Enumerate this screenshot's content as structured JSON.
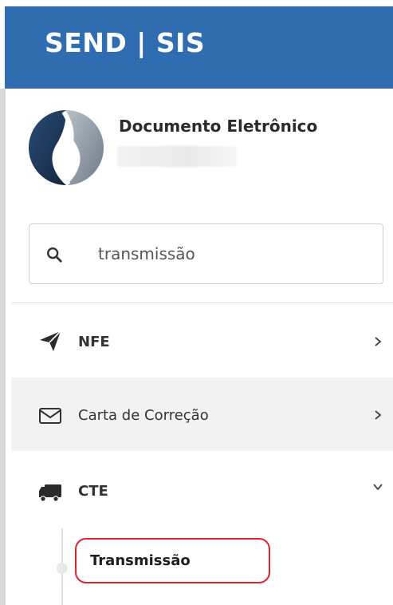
{
  "header": {
    "brand": "SEND | SIS"
  },
  "profile": {
    "title": "Documento Eletrônico",
    "logo_icon": "company-logo"
  },
  "search": {
    "value": "transmissão",
    "icon": "search-icon"
  },
  "menu": {
    "items": [
      {
        "label": "NFE",
        "icon": "paper-plane-icon",
        "chevron": "chevron-right-icon",
        "active": false
      },
      {
        "label": "Carta de Correção",
        "icon": "envelope-icon",
        "chevron": "chevron-right-icon",
        "active": true
      },
      {
        "label": "CTE",
        "icon": "truck-icon",
        "chevron": "chevron-down-icon",
        "expanded": true,
        "children": [
          {
            "label": "Transmissão",
            "highlighted": true
          }
        ]
      }
    ]
  },
  "colors": {
    "header_bg": "#2f6db0",
    "highlight_border": "#e0202a"
  }
}
